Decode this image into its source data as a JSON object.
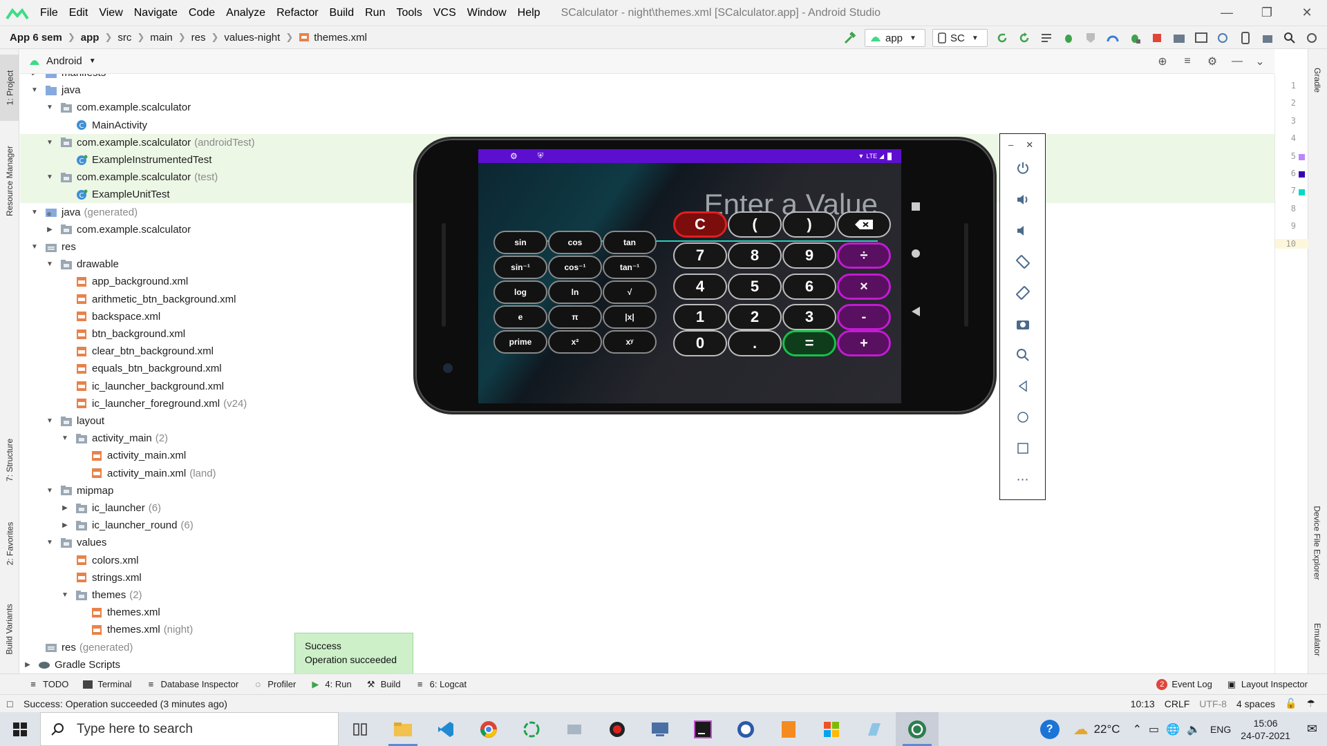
{
  "menubar": {
    "items": [
      "File",
      "Edit",
      "View",
      "Navigate",
      "Code",
      "Analyze",
      "Refactor",
      "Build",
      "Run",
      "Tools",
      "VCS",
      "Window",
      "Help"
    ],
    "window_title": "SCalculator - night\\themes.xml [SCalculator.app] - Android Studio"
  },
  "navbar": {
    "crumbs": [
      "App 6 sem",
      "app",
      "src",
      "main",
      "res",
      "values-night",
      "themes.xml"
    ],
    "run_config": "app",
    "device": "SC"
  },
  "side_tabs": {
    "project": "1: Project",
    "resource_manager": "Resource Manager",
    "structure": "7: Structure",
    "favorites": "2: Favorites",
    "build_variants": "Build Variants",
    "gradle": "Gradle",
    "device_file_explorer": "Device File Explorer",
    "emulator": "Emulator"
  },
  "project_panel": {
    "view_mode": "Android",
    "tree": [
      {
        "label": "manifests",
        "extra": ""
      },
      {
        "label": "java",
        "extra": ""
      },
      {
        "label": "com.example.scalculator",
        "extra": ""
      },
      {
        "label": "MainActivity",
        "extra": ""
      },
      {
        "label": "com.example.scalculator",
        "extra": "(androidTest)"
      },
      {
        "label": "ExampleInstrumentedTest",
        "extra": ""
      },
      {
        "label": "com.example.scalculator",
        "extra": "(test)"
      },
      {
        "label": "ExampleUnitTest",
        "extra": ""
      },
      {
        "label": "java",
        "extra": "(generated)"
      },
      {
        "label": "com.example.scalculator",
        "extra": ""
      },
      {
        "label": "res",
        "extra": ""
      },
      {
        "label": "drawable",
        "extra": ""
      },
      {
        "label": "app_background.xml",
        "extra": ""
      },
      {
        "label": "arithmetic_btn_background.xml",
        "extra": ""
      },
      {
        "label": "backspace.xml",
        "extra": ""
      },
      {
        "label": "btn_background.xml",
        "extra": ""
      },
      {
        "label": "clear_btn_background.xml",
        "extra": ""
      },
      {
        "label": "equals_btn_background.xml",
        "extra": ""
      },
      {
        "label": "ic_launcher_background.xml",
        "extra": ""
      },
      {
        "label": "ic_launcher_foreground.xml",
        "extra": "(v24)"
      },
      {
        "label": "layout",
        "extra": ""
      },
      {
        "label": "activity_main",
        "extra": "(2)"
      },
      {
        "label": "activity_main.xml",
        "extra": ""
      },
      {
        "label": "activity_main.xml",
        "extra": "(land)"
      },
      {
        "label": "mipmap",
        "extra": ""
      },
      {
        "label": "ic_launcher",
        "extra": "(6)"
      },
      {
        "label": "ic_launcher_round",
        "extra": "(6)"
      },
      {
        "label": "values",
        "extra": ""
      },
      {
        "label": "colors.xml",
        "extra": ""
      },
      {
        "label": "strings.xml",
        "extra": ""
      },
      {
        "label": "themes",
        "extra": "(2)"
      },
      {
        "label": "themes.xml",
        "extra": ""
      },
      {
        "label": "themes.xml",
        "extra": "(night)"
      },
      {
        "label": "res",
        "extra": "(generated)"
      },
      {
        "label": "Gradle Scripts",
        "extra": ""
      }
    ]
  },
  "editor": {
    "line_numbers": [
      "1",
      "2",
      "3",
      "4",
      "5",
      "6",
      "7",
      "8",
      "9",
      "10"
    ],
    "swatch_colors": [
      "#bb86fc",
      "#3700b3",
      "#03dac5"
    ]
  },
  "emulator": {
    "status_right": "LTE",
    "display_placeholder": "Enter a Value",
    "sci_keys": [
      "sin",
      "cos",
      "tan",
      "sin⁻¹",
      "cos⁻¹",
      "tan⁻¹",
      "log",
      "ln",
      "√",
      "e",
      "π",
      "|x|",
      "prime",
      "x²",
      "xʸ"
    ],
    "keys": {
      "clear": "C",
      "open_paren": "(",
      "close_paren": ")",
      "seven": "7",
      "eight": "8",
      "nine": "9",
      "divide": "÷",
      "four": "4",
      "five": "5",
      "six": "6",
      "multiply": "×",
      "one": "1",
      "two": "2",
      "three": "3",
      "minus": "-",
      "zero": "0",
      "dot": ".",
      "equals": "=",
      "plus": "+"
    },
    "accent_colors": {
      "status_bar": "#5d0fcf",
      "underline": "#27d2c0",
      "operator": "#c21bd4",
      "clear": "#e02020",
      "equals": "#18c24a"
    }
  },
  "toast": {
    "title": "Success",
    "message": "Operation succeeded"
  },
  "bottom_tabs": {
    "todo": "TODO",
    "terminal": "Terminal",
    "db": "Database Inspector",
    "profiler": "Profiler",
    "run": "4: Run",
    "build": "Build",
    "logcat": "6: Logcat",
    "event_log_count": "2",
    "event_log": "Event Log",
    "layout_inspector": "Layout Inspector"
  },
  "status": {
    "message": "Success: Operation succeeded (3 minutes ago)",
    "position": "10:13",
    "line_sep": "CRLF",
    "encoding": "UTF-8",
    "indent": "4 spaces"
  },
  "taskbar": {
    "search_placeholder": "Type here to search",
    "temperature": "22°C",
    "lang": "ENG",
    "time": "15:06",
    "date": "24-07-2021"
  }
}
